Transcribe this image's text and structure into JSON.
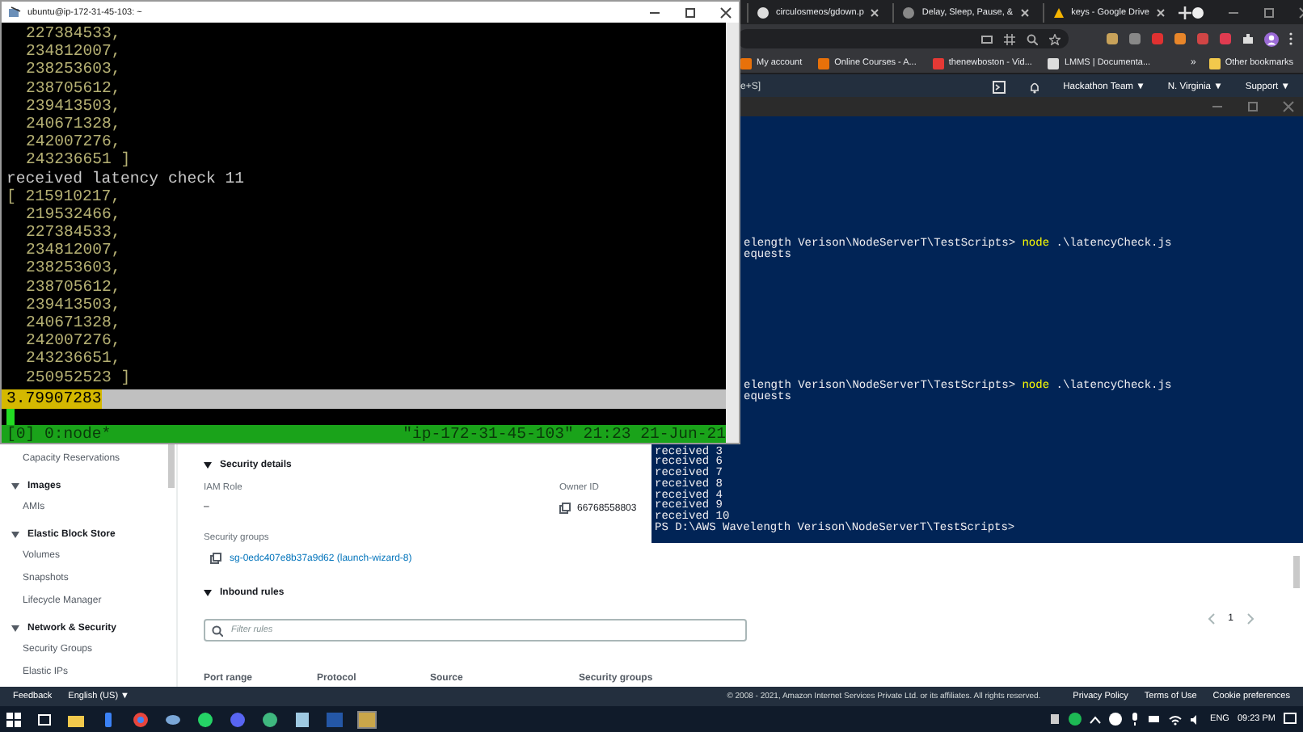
{
  "browser": {
    "tabs": [
      {
        "title": "circulosmeos/gdown.p"
      },
      {
        "title": "Delay, Sleep, Pause, &"
      },
      {
        "title": "keys - Google Drive"
      }
    ],
    "address_fragment": "e+S]",
    "bookmarks": [
      "My account",
      "Online Courses - A...",
      "thenewboston - Vid...",
      "LMMS | Documenta..."
    ],
    "bookmarks_overflow": "»",
    "other_bookmarks": "Other bookmarks"
  },
  "aws": {
    "header_menus": [
      "Hackathon Team ▼",
      "N. Virginia ▼",
      "Support ▼"
    ],
    "sidebar": [
      {
        "label": "Capacity Reservations",
        "kind": "link"
      },
      {
        "label": "Images",
        "kind": "group"
      },
      {
        "label": "AMIs",
        "kind": "link"
      },
      {
        "label": "Elastic Block Store",
        "kind": "group"
      },
      {
        "label": "Volumes",
        "kind": "link"
      },
      {
        "label": "Snapshots",
        "kind": "link"
      },
      {
        "label": "Lifecycle Manager",
        "kind": "link"
      },
      {
        "label": "Network & Security",
        "kind": "group"
      },
      {
        "label": "Security Groups",
        "kind": "link"
      },
      {
        "label": "Elastic IPs",
        "kind": "link"
      }
    ],
    "security_details": {
      "heading": "Security details",
      "iam_role_label": "IAM Role",
      "iam_role_value": "–",
      "owner_id_label": "Owner ID",
      "owner_id_value": "66768558803",
      "security_groups_label": "Security groups",
      "security_group_link": "sg-0edc407e8b37a9d62 (launch-wizard-8)"
    },
    "inbound_rules": {
      "heading": "Inbound rules",
      "filter": {
        "placeholder": "Filter rules"
      },
      "page": "1",
      "columns": [
        "Port range",
        "Protocol",
        "Source",
        "Security groups"
      ]
    },
    "footer": {
      "feedback": "Feedback",
      "language": "English (US) ▼",
      "copyright": "© 2008 - 2021, Amazon Internet Services Private Ltd. or its affiliates. All rights reserved.",
      "links": [
        "Privacy Policy",
        "Terms of Use",
        "Cookie preferences"
      ]
    }
  },
  "powershell": {
    "blocks": [
      [
        {
          "text": "elength Verison\\NodeServerT\\TestScripts> ",
          "command": "node",
          "args": " .\\latencyCheck.js"
        },
        {
          "text": "equests"
        }
      ],
      [
        {
          "text": "elength Verison\\NodeServerT\\TestScripts> ",
          "command": "node",
          "args": " .\\latencyCheck.js"
        },
        {
          "text": "equests"
        }
      ],
      [
        {
          "text": "received 3"
        },
        {
          "text": "received 6"
        },
        {
          "text": "received 7"
        },
        {
          "text": "received 8"
        },
        {
          "text": "received 4"
        },
        {
          "text": "received 9"
        },
        {
          "text": "received 10"
        },
        {
          "text": "PS D:\\AWS Wavelength Verison\\NodeServerT\\TestScripts>"
        }
      ]
    ]
  },
  "terminal": {
    "title": "ubuntu@ip-172-31-45-103: ~",
    "lines": [
      {
        "text": "227384533,",
        "kind": "item"
      },
      {
        "text": "234812007,",
        "kind": "item"
      },
      {
        "text": "238253603,",
        "kind": "item"
      },
      {
        "text": "238705612,",
        "kind": "item"
      },
      {
        "text": "239413503,",
        "kind": "item"
      },
      {
        "text": "240671328,",
        "kind": "item"
      },
      {
        "text": "242007276,",
        "kind": "item"
      },
      {
        "text": "243236651 ]",
        "kind": "item"
      },
      {
        "text": "received latency check 11",
        "kind": "message"
      },
      {
        "text": "[ 215910217,",
        "kind": "open"
      },
      {
        "text": "219532466,",
        "kind": "item"
      },
      {
        "text": "227384533,",
        "kind": "item"
      },
      {
        "text": "234812007,",
        "kind": "item"
      },
      {
        "text": "238253603,",
        "kind": "item"
      },
      {
        "text": "238705612,",
        "kind": "item"
      },
      {
        "text": "239413503,",
        "kind": "item"
      },
      {
        "text": "240671328,",
        "kind": "item"
      },
      {
        "text": "242007276,",
        "kind": "item"
      },
      {
        "text": "243236651,",
        "kind": "item"
      },
      {
        "text": "250952523 ]",
        "kind": "item"
      }
    ],
    "selection": "3.79907283",
    "status_left": "[0] 0:node*",
    "status_right": "\"ip-172-31-45-103\" 21:23 21-Jun-21"
  },
  "taskbar": {
    "language": "ENG",
    "time": "09:23 PM"
  }
}
